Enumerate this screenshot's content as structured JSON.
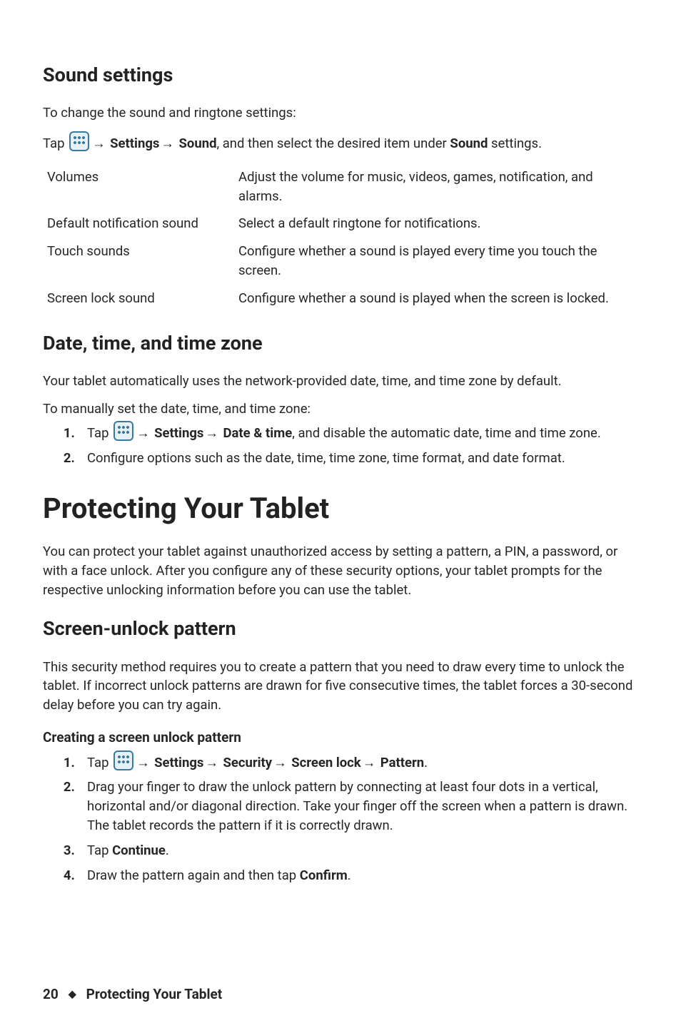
{
  "section_sound": {
    "heading": "Sound settings",
    "intro": "To change the sound and ringtone settings:",
    "tap_pre": "Tap ",
    "arrow": "→",
    "path1": "Settings",
    "path2": "Sound",
    "tap_mid": ", and then select the desired item under ",
    "path3": "Sound",
    "tap_post": " settings.",
    "rows": [
      {
        "label": "Volumes",
        "desc": "Adjust the volume for music, videos, games, notification, and alarms."
      },
      {
        "label": "Default notification sound",
        "desc": "Select a default ringtone for notifications."
      },
      {
        "label": "Touch sounds",
        "desc": "Configure whether a sound is played every time you touch the screen."
      },
      {
        "label": "Screen lock sound",
        "desc": "Configure whether a sound is played when the screen is locked."
      }
    ]
  },
  "section_date": {
    "heading": "Date, time, and time zone",
    "para1": "Your tablet automatically uses the network-provided date, time, and time zone by default.",
    "para2": "To manually set the date, time, and time zone:",
    "step1_pre": "Tap ",
    "step1_p1": "Settings",
    "step1_p2": "Date & time",
    "step1_post": ", and disable the automatic date, time and time zone.",
    "step2": "Configure options such as the date, time, time zone, time format, and date format."
  },
  "section_protect": {
    "heading": "Protecting Your Tablet",
    "para": "You can protect your tablet against unauthorized access by setting a pattern, a PIN, a password, or with a face unlock. After you configure any of these security options, your tablet prompts for the respective unlocking information before you can use the tablet."
  },
  "section_pattern": {
    "heading": "Screen-unlock pattern",
    "para": "This security method requires you to create a pattern that you need to draw every time to unlock the tablet. If incorrect unlock patterns are drawn for five consecutive times, the tablet forces a 30-second delay before you can try again.",
    "sub_heading": "Creating a screen unlock pattern",
    "step1_pre": "Tap ",
    "step1_p1": "Settings",
    "step1_p2": "Security",
    "step1_p3": "Screen lock",
    "step1_p4": "Pattern",
    "step1_post": ".",
    "step2a": "Drag your finger to draw the unlock pattern by connecting at least four dots in a vertical, horizontal and/or diagonal direction. Take your finger off the screen when a pattern is drawn.",
    "step2b": "The tablet records the pattern if it is correctly drawn.",
    "step3_pre": "Tap ",
    "step3_bold": "Continue",
    "step3_post": ".",
    "step4_pre": "Draw the pattern again and then tap ",
    "step4_bold": "Confirm",
    "step4_post": "."
  },
  "footer": {
    "page_number": "20",
    "diamond": "◆",
    "title": "Protecting Your Tablet"
  }
}
